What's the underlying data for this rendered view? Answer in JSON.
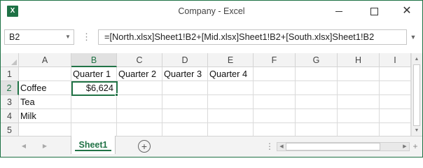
{
  "window": {
    "title": "Company - Excel",
    "app_icon_letter": "X",
    "minimize_icon": "minimize-icon",
    "maximize_icon": "maximize-icon",
    "close_glyph": "✕",
    "restore_glyph": "⧉"
  },
  "formula_bar": {
    "name_box": "B2",
    "formula": "=[North.xlsx]Sheet1!B2+[Mid.xlsx]Sheet1!B2+[South.xlsx]Sheet1!B2",
    "dots": "⋮"
  },
  "grid": {
    "columns": [
      "A",
      "B",
      "C",
      "D",
      "E",
      "F",
      "G",
      "H",
      "I"
    ],
    "rows": [
      "1",
      "2",
      "3",
      "4",
      "5"
    ],
    "cells": {
      "B1": "Quarter 1",
      "C1": "Quarter 2",
      "D1": "Quarter 3",
      "E1": "Quarter 4",
      "A2": "Coffee",
      "B2": "$6,624",
      "A3": "Tea",
      "A4": "Milk"
    },
    "selected_cell": "B2",
    "selected_column": "B",
    "selected_row": "2"
  },
  "sheets": {
    "active_tab": "Sheet1",
    "add_sheet_glyph": "+"
  },
  "colors": {
    "accent": "#217346",
    "header_bg": "#f3f3f3",
    "gridline": "#dadada"
  }
}
